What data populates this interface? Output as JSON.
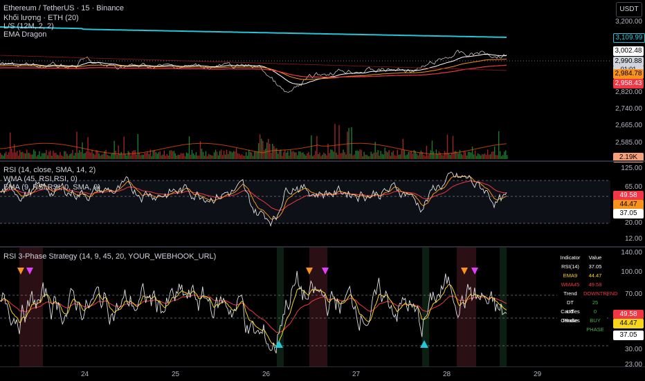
{
  "header": {
    "symbol": "Ethereum / TetherUS · 15 · Binance",
    "volume": "Khối lượng · ETH (20)",
    "ls": "L/S (12M, 2, 2)",
    "ema": "EMA Dragon",
    "currency_button": "USDT"
  },
  "price_pane": {
    "ticks": [
      "3,200.00",
      "2,820.00",
      "2,740.00",
      "2,665.00",
      "2,585.00"
    ],
    "labels": {
      "cyan": "3,109.99",
      "white": "3,002.48",
      "last_price": "2,990.88",
      "countdown": "01:01",
      "orange": "2,984.78",
      "red": "2,958.43",
      "volume": "2.19K"
    }
  },
  "rsi_pane": {
    "legend": [
      "RSI (14, close, SMA, 14, 2)",
      "WMA (45, RSI,RSI, 0)",
      "EMA (9, RSI,RSI, 0, SMA, 9)"
    ],
    "ticks": [
      "125.00",
      "65.00",
      "20.00",
      "12.00"
    ],
    "labels": {
      "red": "49.58",
      "orange": "44.47",
      "white": "37.05"
    }
  },
  "strategy_pane": {
    "legend": "RSI 3-Phase Strategy (14, 9, 45, 20, YOUR_WEBHOOK_URL)",
    "ticks": [
      "140.00",
      "100.00",
      "70.00",
      "50.00",
      "30.00",
      "23.00"
    ],
    "labels": {
      "red": "49.58",
      "orange": "44.47",
      "white": "37.05"
    },
    "table": {
      "header": [
        "Indicator",
        "Value"
      ],
      "rows": [
        {
          "k": "RSI(14)",
          "v": "37.05"
        },
        {
          "k": "EMA9",
          "v": "44.47"
        },
        {
          "k": "WMA45",
          "v": "49.58"
        },
        {
          "k": "Trend",
          "v": "DOWNTREND"
        },
        {
          "k": "DT Candles",
          "v": "25"
        },
        {
          "k": "UT Candles",
          "v": "0"
        },
        {
          "k": "Phase",
          "v": "BUY PHASE"
        }
      ]
    }
  },
  "time_axis": [
    "24",
    "25",
    "26",
    "27",
    "28",
    "29"
  ],
  "colors": {
    "background": "#000000",
    "cyan": "#26c6da",
    "orange": "#f7931a",
    "red": "#f23645",
    "magenta": "#e040fb",
    "teal": "#26c6da",
    "green_volume": "#1b5e20",
    "red_volume": "#8b1a1a"
  }
}
